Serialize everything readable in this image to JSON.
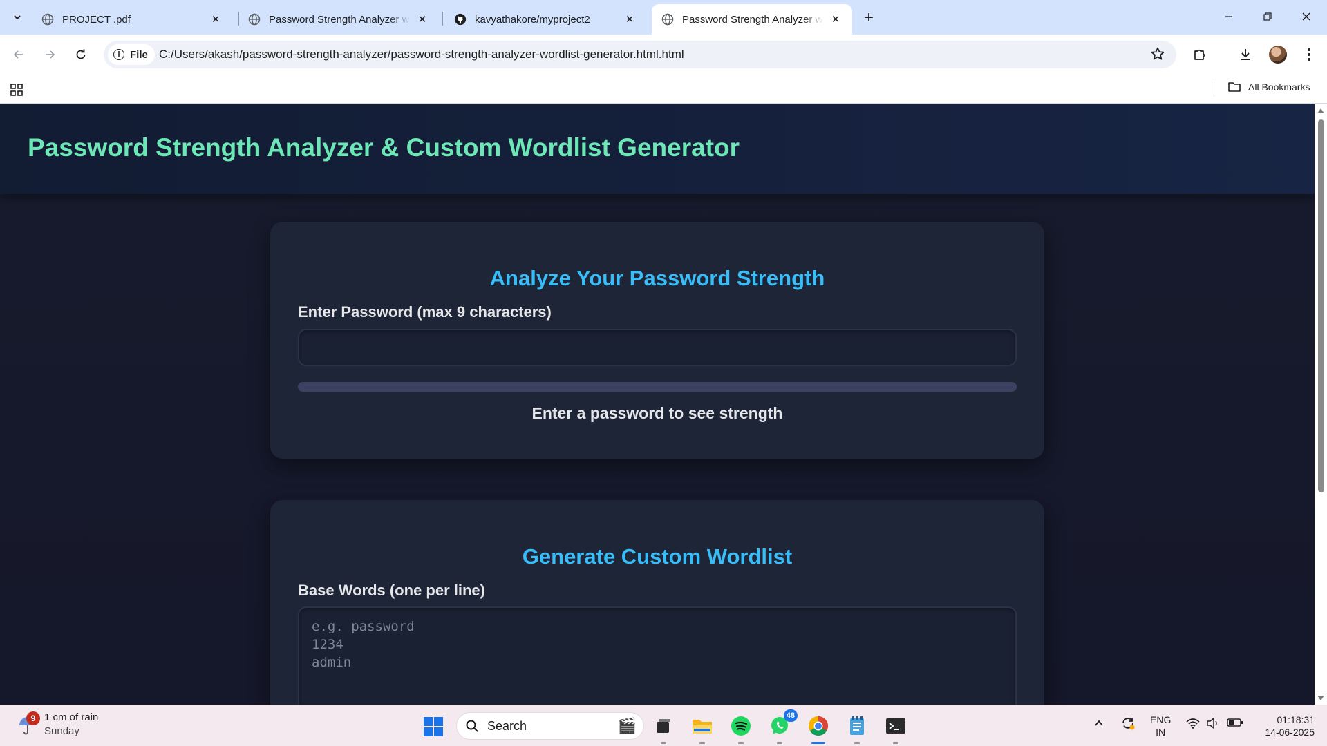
{
  "browser": {
    "tabs": [
      {
        "title": "PROJECT .pdf",
        "icon": "globe-icon",
        "active": false
      },
      {
        "title": "Password Strength Analyzer with Custom Wordlist Generator",
        "icon": "globe-icon",
        "active": false
      },
      {
        "title": "kavyathakore/myproject2",
        "icon": "github-icon",
        "active": false
      },
      {
        "title": "Password Strength Analyzer with Custom Wordlist Generator",
        "icon": "globe-icon",
        "active": true
      }
    ],
    "new_tab": "+",
    "chip_label": "File",
    "url": "C:/Users/akash/password-strength-analyzer/password-strength-analyzer-wordlist-generator.html.html",
    "bookmarks_label": "All Bookmarks"
  },
  "page": {
    "title": "Password Strength Analyzer & Custom Wordlist Generator",
    "analyzer": {
      "heading": "Analyze Your Password Strength",
      "label": "Enter Password (max 9 characters)",
      "value": "",
      "strength_text": "Enter a password to see strength",
      "strength_fraction": 0
    },
    "wordlist": {
      "heading": "Generate Custom Wordlist",
      "label": "Base Words (one per line)",
      "placeholder": "e.g. password\n1234\nadmin"
    },
    "colors": {
      "title": "#6ee7b7",
      "heading": "#38bdf8",
      "card": "#1e2536",
      "background": "#171a2b"
    }
  },
  "taskbar": {
    "weather": {
      "badge": "9",
      "line1": "1 cm of rain",
      "line2": "Sunday"
    },
    "search_placeholder": "Search",
    "whatsapp_badge": "48",
    "language": {
      "line1": "ENG",
      "line2": "IN"
    },
    "clock": {
      "time": "01:18:31",
      "date": "14-06-2025"
    }
  }
}
